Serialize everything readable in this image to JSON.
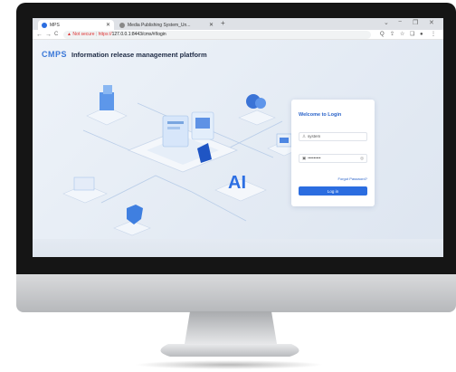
{
  "browser": {
    "tabs": [
      {
        "label": "MPS",
        "active": true
      },
      {
        "label": "Media Publishing System_Un...",
        "active": false
      }
    ],
    "new_tab_label": "+",
    "window_controls": [
      "⌄",
      "−",
      "❐",
      "✕"
    ],
    "nav": {
      "back": "←",
      "forward": "→",
      "reload": "C"
    },
    "address": {
      "security_warning": "▲ Not secure",
      "url_https": "https://",
      "url_rest": "127.0.0.1:8443/cms/#/login"
    },
    "toolbar_icons": [
      "Q",
      "⇪",
      "☆",
      "❑",
      "●",
      "⋮"
    ]
  },
  "app": {
    "logo_mark": "CMPS",
    "platform_title": "Information release management platform"
  },
  "login": {
    "title": "Welcome to Login",
    "username_value": "system",
    "password_value": "•••••••••",
    "forgot_label": "Forgot Password?",
    "button_label": "Log in"
  },
  "colors": {
    "accent": "#2b6de0",
    "title_blue": "#2a63c9",
    "page_bg": "#e9eef5"
  }
}
